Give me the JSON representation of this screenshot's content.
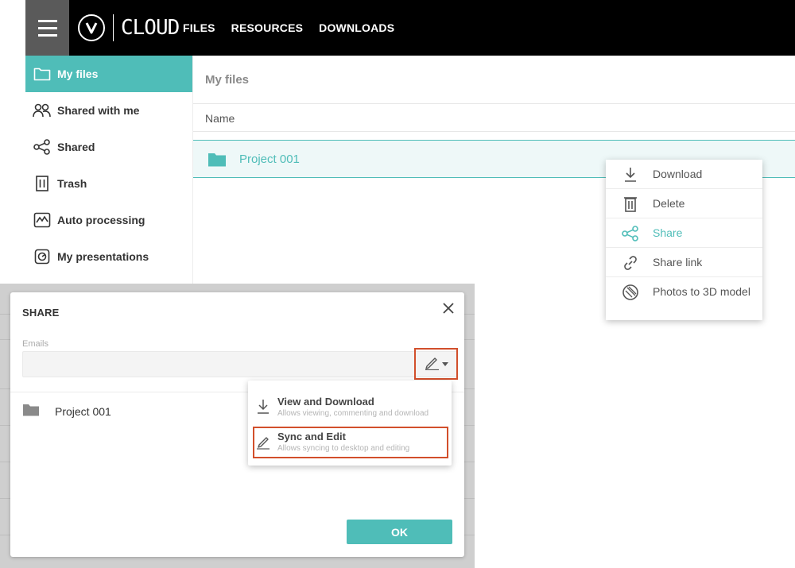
{
  "header": {
    "logo_text": "CLOUD",
    "nav": [
      "FILES",
      "RESOURCES",
      "DOWNLOADS"
    ]
  },
  "sidebar": {
    "items": [
      {
        "label": "My files",
        "icon": "folder-icon",
        "active": true
      },
      {
        "label": "Shared with me",
        "icon": "people-icon"
      },
      {
        "label": "Shared",
        "icon": "share-icon"
      },
      {
        "label": "Trash",
        "icon": "trash-icon"
      },
      {
        "label": "Auto processing",
        "icon": "chart-icon"
      },
      {
        "label": "My presentations",
        "icon": "presentation-icon"
      }
    ]
  },
  "main": {
    "title": "My files",
    "column_name": "Name",
    "rows": [
      {
        "name": "Project 001",
        "icon": "folder-icon",
        "selected": true
      }
    ]
  },
  "context_menu": {
    "items": [
      {
        "label": "Download",
        "icon": "download-icon"
      },
      {
        "label": "Delete",
        "icon": "trash-icon"
      },
      {
        "label": "Share",
        "icon": "share-icon",
        "highlighted": true
      },
      {
        "label": "Share link",
        "icon": "link-icon"
      },
      {
        "label": "Photos to 3D model",
        "icon": "photo-3d-icon"
      }
    ]
  },
  "share_dialog": {
    "title": "SHARE",
    "emails_label": "Emails",
    "emails_value": "",
    "item_name": "Project 001",
    "ok_label": "OK"
  },
  "permission_menu": {
    "items": [
      {
        "title": "View and Download",
        "desc": "Allows viewing, commenting and download",
        "icon": "download-icon"
      },
      {
        "title": "Sync and Edit",
        "desc": "Allows syncing to desktop and editing",
        "icon": "pencil-icon",
        "selected": true
      }
    ]
  },
  "colors": {
    "accent": "#4fbdb8",
    "highlight_outline": "#d24f2b",
    "topbar": "#000000"
  }
}
